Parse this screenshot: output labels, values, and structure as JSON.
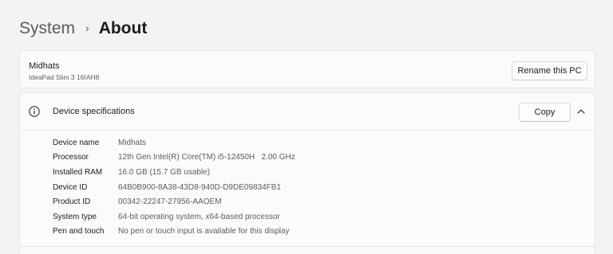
{
  "breadcrumb": {
    "parent": "System",
    "separator": "›",
    "current": "About"
  },
  "pc": {
    "name": "Midhats",
    "model": "IdeaPad Slim 3 16IAH8",
    "rename_label": "Rename this PC"
  },
  "device_specs": {
    "icon": "info-icon",
    "title": "Device specifications",
    "copy_label": "Copy",
    "collapse_icon": "chevron-up-icon",
    "rows": [
      {
        "label": "Device name",
        "value": "Midhats"
      },
      {
        "label": "Processor",
        "value": "12th Gen Intel(R) Core(TM) i5-12450H   2.00 GHz"
      },
      {
        "label": "Installed RAM",
        "value": "16.0 GB (15.7 GB usable)"
      },
      {
        "label": "Device ID",
        "value": "64B0B900-8A38-43D8-940D-D9DE09834FB1"
      },
      {
        "label": "Product ID",
        "value": "00342-22247-27956-AAOEM"
      },
      {
        "label": "System type",
        "value": "64-bit operating system, x64-based processor"
      },
      {
        "label": "Pen and touch",
        "value": "No pen or touch input is available for this display"
      }
    ]
  },
  "colors": {
    "background": "#f3f3f3",
    "card": "#fbfbfb",
    "text_primary": "#1b1b1b",
    "text_secondary": "#5c5c5c"
  }
}
